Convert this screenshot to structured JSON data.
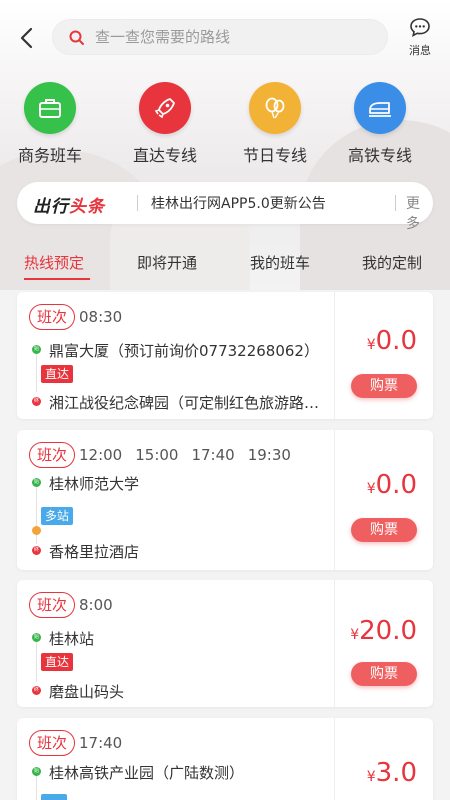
{
  "header": {
    "search_placeholder": "查一查您需要的路线",
    "message_label": "消息"
  },
  "categories": [
    {
      "label": "商务班车",
      "icon": "briefcase-icon",
      "color": "#35c14a"
    },
    {
      "label": "直达专线",
      "icon": "rocket-icon",
      "color": "#e8343c"
    },
    {
      "label": "节日专线",
      "icon": "balloon-icon",
      "color": "#f2b236"
    },
    {
      "label": "高铁专线",
      "icon": "train-icon",
      "color": "#3a8ee8"
    }
  ],
  "headline": {
    "brand_part1": "出行",
    "brand_part2": "头条",
    "news": "桂林出行网APP5.0更新公告",
    "more": "更多"
  },
  "tabs": [
    "热线预定",
    "即将开通",
    "我的班车",
    "我的定制"
  ],
  "routes": [
    {
      "shift_label": "班次",
      "times": [
        "08:30"
      ],
      "start_dot": "始",
      "end_dot": "终",
      "start": "鼎富大厦（预订前询价07732268062）",
      "tag": "直达",
      "end": "湘江战役纪念碑园（可定制红色旅游路线）",
      "currency": "¥",
      "price": "0.0",
      "buy_label": "购票"
    },
    {
      "shift_label": "班次",
      "times": [
        "12:00",
        "15:00",
        "17:40",
        "19:30"
      ],
      "start_dot": "始",
      "end_dot": "终",
      "start": "桂林师范大学",
      "tag": "多站",
      "end": "香格里拉酒店",
      "currency": "¥",
      "price": "0.0",
      "buy_label": "购票"
    },
    {
      "shift_label": "班次",
      "times": [
        "8:00"
      ],
      "start_dot": "始",
      "end_dot": "终",
      "start": "桂林站",
      "tag": "直达",
      "end": "磨盘山码头",
      "currency": "¥",
      "price": "20.0",
      "buy_label": "购票"
    },
    {
      "shift_label": "班次",
      "times": [
        "17:40"
      ],
      "start_dot": "始",
      "start": "桂林高铁产业园（广陆数测）",
      "currency": "¥",
      "price": "3.0"
    }
  ],
  "colors": {
    "accent": "#e8343c",
    "start_dot": "#35b44a",
    "multi_tag": "#4aa9e8"
  }
}
